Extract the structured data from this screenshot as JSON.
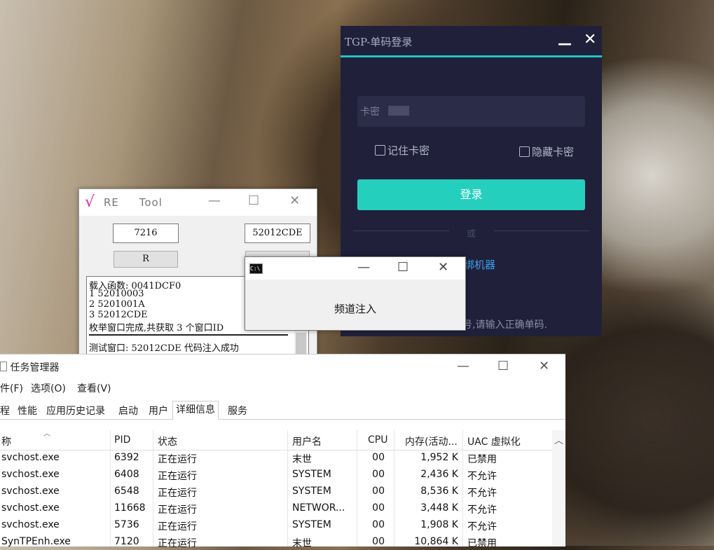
{
  "tgp": {
    "title": "TGP-单码登录",
    "min": "—",
    "close": "✕",
    "card_placeholder": "卡密",
    "remember": "记住卡密",
    "hide": "隐藏卡密",
    "login": "登录",
    "or": "或",
    "link": "绑机器",
    "hint": "号,请输入正确单码.",
    "accent": "#24cfbd"
  },
  "retool": {
    "logo": "√",
    "title": "RE     Tool",
    "min": "—",
    "max": "☐",
    "close": "✕",
    "field_left": "7216",
    "field_right": "52012CDE",
    "btn_left": "R",
    "btn_right": "",
    "log": [
      "载入函数: 0041DCF0",
      "1 52010003",
      "2 5201001A",
      "3 52012CDE",
      "枚举窗口完成,共获取 3 个窗口ID",
      "测试窗口: 52012CDE 代码注入成功"
    ],
    "scroll_down": "⌄"
  },
  "cmd": {
    "icon": "C:\\",
    "min": "—",
    "max": "☐",
    "close": "✕",
    "label": "频道注入"
  },
  "taskmgr": {
    "title": "任务管理器",
    "min": "—",
    "max": "☐",
    "close": "✕",
    "menu": [
      "件(F)",
      "选项(O)",
      "查看(V)"
    ],
    "tabs": [
      "程",
      "性能",
      "应用历史记录",
      "启动",
      "用户",
      "详细信息",
      "服务"
    ],
    "headers": [
      "称",
      "PID",
      "状态",
      "用户名",
      "CPU",
      "内存(活动...",
      "UAC 虚拟化"
    ],
    "rows": [
      [
        "svchost.exe",
        "6392",
        "正在运行",
        "末世",
        "00",
        "1,952 K",
        "已禁用"
      ],
      [
        "svchost.exe",
        "6408",
        "正在运行",
        "SYSTEM",
        "00",
        "2,436 K",
        "不允许"
      ],
      [
        "svchost.exe",
        "6548",
        "正在运行",
        "SYSTEM",
        "00",
        "8,536 K",
        "不允许"
      ],
      [
        "svchost.exe",
        "11668",
        "正在运行",
        "NETWOR...",
        "00",
        "3,448 K",
        "不允许"
      ],
      [
        "svchost.exe",
        "5736",
        "正在运行",
        "SYSTEM",
        "00",
        "1,908 K",
        "不允许"
      ],
      [
        "SynTPEnh.exe",
        "7120",
        "正在运行",
        "末世",
        "00",
        "10,864 K",
        "已禁用"
      ]
    ]
  }
}
